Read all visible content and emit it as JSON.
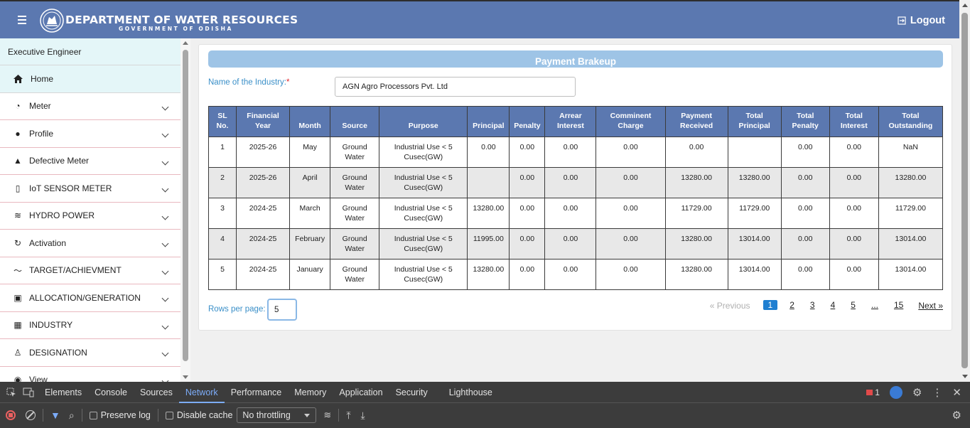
{
  "header": {
    "title": "DEPARTMENT OF WATER RESOURCES",
    "subtitle": "GOVERNMENT OF ODISHA",
    "logout_label": "Logout"
  },
  "sidebar": {
    "role": "Executive Engineer",
    "home_label": "Home",
    "items": [
      {
        "label": "Meter",
        "icon": "meter-icon"
      },
      {
        "label": "Profile",
        "icon": "person-icon"
      },
      {
        "label": "Defective Meter",
        "icon": "warning-icon"
      },
      {
        "label": "IoT SENSOR METER",
        "icon": "sensor-icon"
      },
      {
        "label": "HYDRO POWER",
        "icon": "waves-icon"
      },
      {
        "label": "Activation",
        "icon": "refresh-icon"
      },
      {
        "label": "TARGET/ACHIEVMENT",
        "icon": "trend-icon"
      },
      {
        "label": "ALLOCATION/GENERATION",
        "icon": "document-icon"
      },
      {
        "label": "INDUSTRY",
        "icon": "building-icon"
      },
      {
        "label": "DESIGNATION",
        "icon": "user-outline-icon"
      },
      {
        "label": "View",
        "icon": "eye-icon"
      }
    ]
  },
  "main": {
    "banner_title": "Payment Brakeup",
    "industry_label": "Name of the Industry:",
    "industry_required": "*",
    "industry_value": "AGN Agro Processors Pvt. Ltd",
    "table": {
      "headers": [
        "SL No.",
        "Financial Year",
        "Month",
        "Source",
        "Purpose",
        "Principal",
        "Penalty",
        "Arrear Interest",
        "Comminent Charge",
        "Payment Received",
        "Total Principal",
        "Total Penalty",
        "Total Interest",
        "Total Outstanding"
      ],
      "rows": [
        [
          "1",
          "2025-26",
          "May",
          "Ground Water",
          "Industrial Use < 5 Cusec(GW)",
          "0.00",
          "0.00",
          "0.00",
          "0.00",
          "0.00",
          "",
          "0.00",
          "0.00",
          "NaN"
        ],
        [
          "2",
          "2025-26",
          "April",
          "Ground Water",
          "Industrial Use < 5 Cusec(GW)",
          "",
          "0.00",
          "0.00",
          "0.00",
          "13280.00",
          "13280.00",
          "0.00",
          "0.00",
          "13280.00"
        ],
        [
          "3",
          "2024-25",
          "March",
          "Ground Water",
          "Industrial Use < 5 Cusec(GW)",
          "13280.00",
          "0.00",
          "0.00",
          "0.00",
          "11729.00",
          "11729.00",
          "0.00",
          "0.00",
          "11729.00"
        ],
        [
          "4",
          "2024-25",
          "February",
          "Ground Water",
          "Industrial Use < 5 Cusec(GW)",
          "11995.00",
          "0.00",
          "0.00",
          "0.00",
          "13280.00",
          "13014.00",
          "0.00",
          "0.00",
          "13014.00"
        ],
        [
          "5",
          "2024-25",
          "January",
          "Ground Water",
          "Industrial Use < 5 Cusec(GW)",
          "13280.00",
          "0.00",
          "0.00",
          "0.00",
          "13280.00",
          "13014.00",
          "0.00",
          "0.00",
          "13014.00"
        ]
      ]
    },
    "rows_per_page_label": "Rows per page:",
    "rows_per_page_value": "5",
    "pager": {
      "prev": "« Previous",
      "pages": [
        "1",
        "2",
        "3",
        "4",
        "5",
        "...",
        "15"
      ],
      "active": "1",
      "next": "Next »"
    }
  },
  "devtools": {
    "tabs": [
      "Elements",
      "Console",
      "Sources",
      "Network",
      "Performance",
      "Memory",
      "Application",
      "Security",
      "Lighthouse"
    ],
    "active_tab": "Network",
    "error_count": "1",
    "preserve_log": "Preserve log",
    "disable_cache": "Disable cache",
    "throttling": "No throttling"
  },
  "colors": {
    "header_bg": "#5b78b0",
    "banner_bg": "#9ec4e6",
    "label_blue": "#3a8fc8",
    "active_page": "#1f7fd1"
  }
}
